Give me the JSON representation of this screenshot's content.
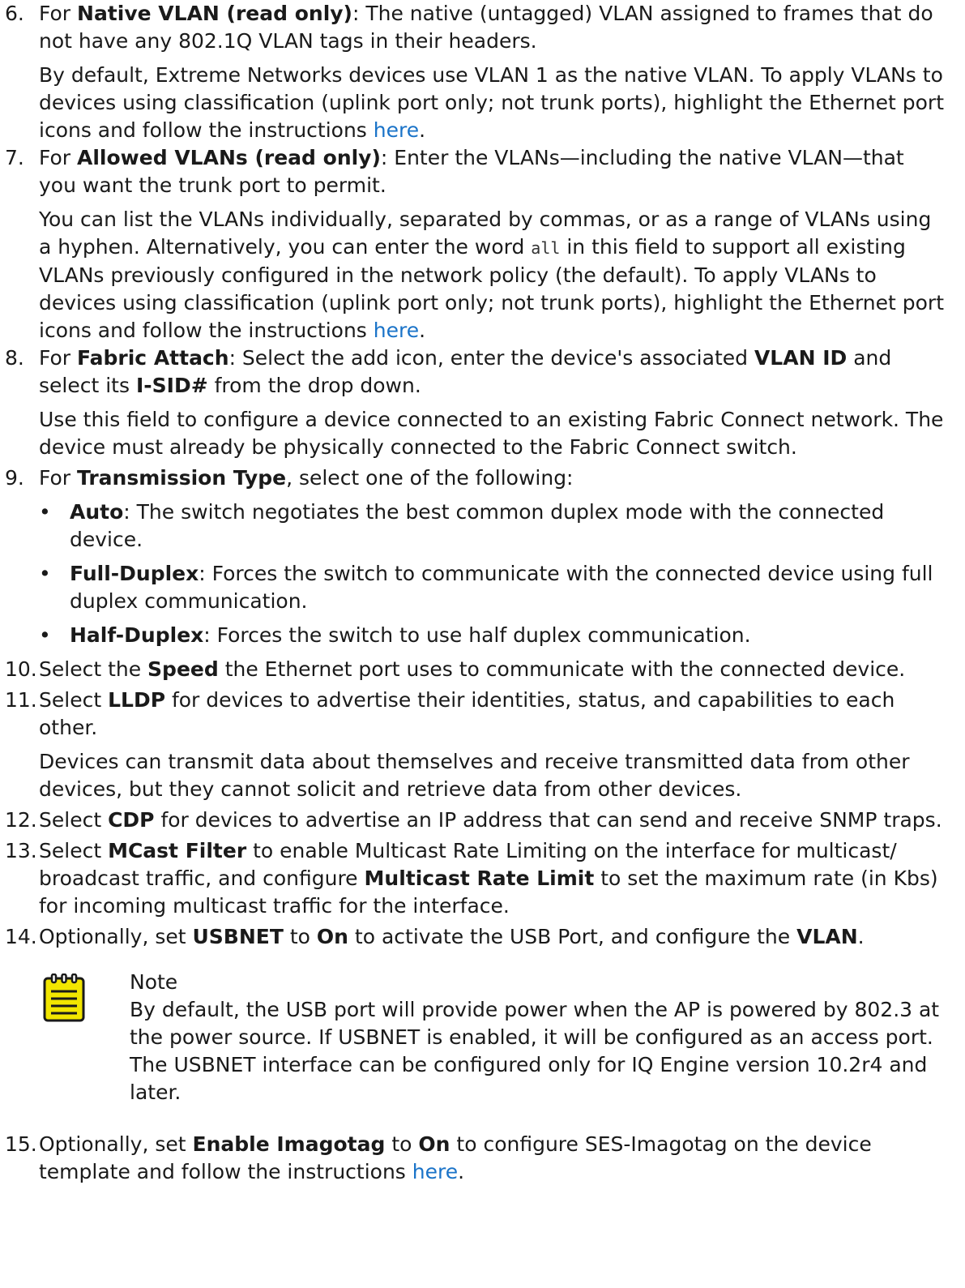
{
  "steps": [
    {
      "num": "6.",
      "pre": "For ",
      "bold": "Native VLAN (read only)",
      "post": ": The native (untagged) VLAN assigned to frames that do not have any 802.1Q VLAN tags in their headers.",
      "extra": "By default, Extreme Networks devices use VLAN 1 as the native VLAN. To apply VLANs to devices using classification (uplink port only; not trunk ports), highlight the Ethernet port icons and follow the instructions ",
      "link": "here",
      "after": "."
    },
    {
      "num": "7.",
      "pre": "For ",
      "bold": "Allowed VLANs (read only)",
      "post": ": Enter the VLANs—including the native VLAN—that you want the trunk port to permit.",
      "extra_a": "You can list the VLANs individually, separated by commas, or as a range of VLANs using a hyphen. Alternatively, you can enter the word ",
      "code": "all",
      "extra_b": " in this field to support all existing VLANs previously configured in the network policy (the default). To apply VLANs to devices using classification (uplink port only; not trunk ports), highlight the Ethernet port icons and follow the instructions ",
      "link": "here",
      "after": "."
    },
    {
      "num": "8.",
      "pre": "For ",
      "bold": "Fabric Attach",
      "mid1": ": Select the add icon, enter the device's associated ",
      "bold2": "VLAN ID",
      "mid2": " and select its ",
      "bold3": "I-SID#",
      "post": " from the drop down.",
      "extra": "Use this field to configure a device connected to an existing Fabric Connect network. The device must already be physically connected to the Fabric Connect switch."
    },
    {
      "num": "9.",
      "pre": "For ",
      "bold": "Transmission Type",
      "post": ", select one of the following:",
      "bullet_glyph": "•",
      "bullets": [
        {
          "bold": "Auto",
          "text": ": The switch negotiates the best common duplex mode with the connected device."
        },
        {
          "bold": "Full-Duplex",
          "text": ": Forces the switch to communicate with the connected device using full duplex communication."
        },
        {
          "bold": "Half-Duplex",
          "text": ": Forces the switch to use half duplex communication."
        }
      ]
    },
    {
      "num": "10.",
      "pre": "Select the ",
      "bold": "Speed",
      "post": " the Ethernet port uses to communicate with the connected device."
    },
    {
      "num": "11.",
      "pre": "Select ",
      "bold": "LLDP",
      "post": " for devices to advertise their identities, status, and capabilities to each other.",
      "extra": "Devices can transmit data about themselves and receive transmitted data from other devices, but they cannot solicit and retrieve data from other devices."
    },
    {
      "num": "12.",
      "pre": "Select ",
      "bold": "CDP",
      "post": " for devices to advertise an IP address that can send and receive SNMP traps."
    },
    {
      "num": "13.",
      "pre": "Select ",
      "bold": "MCast Filter",
      "mid1": " to enable Multicast Rate Limiting on the interface for multicast/ broadcast traffic, and configure ",
      "bold2": "Multicast Rate Limit",
      "post": " to set the maximum rate (in Kbs) for incoming multicast traffic for the interface."
    },
    {
      "num": "14.",
      "pre": "Optionally, set ",
      "bold": "USBNET",
      "mid1": " to ",
      "bold2": "On",
      "mid2": " to activate the USB Port, and configure the ",
      "bold3": "VLAN",
      "post": "."
    },
    {
      "num": "15.",
      "pre": "Optionally, set ",
      "bold": "Enable Imagotag",
      "mid1": " to ",
      "bold2": "On",
      "mid2": " to configure SES-Imagotag on the device template and follow the instructions ",
      "link": "here",
      "after": "."
    }
  ],
  "note": {
    "title": "Note",
    "text": "By default, the USB port will provide power when the AP is powered by 802.3 at the power source. If USBNET is enabled, it will be configured as an access port. The USBNET interface can be configured only for IQ Engine version 10.2r4 and later.",
    "icon": "note-pad-icon",
    "icon_color": "#f2e600"
  },
  "colors": {
    "link": "#1a73c8",
    "text": "#1a1a1a"
  }
}
